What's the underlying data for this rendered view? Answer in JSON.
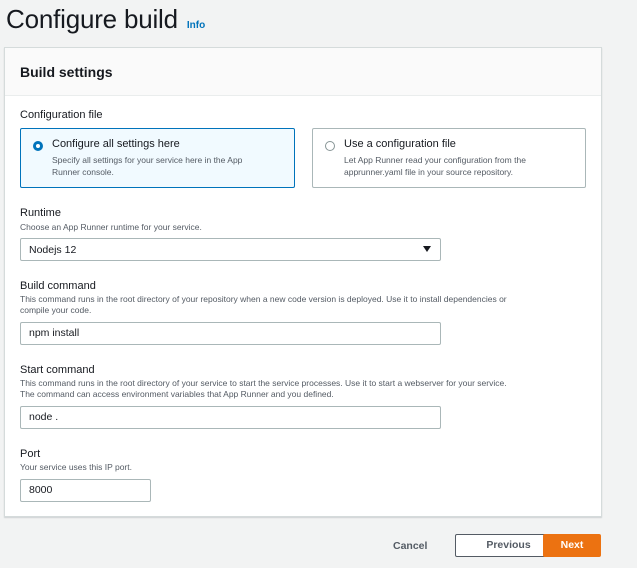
{
  "header": {
    "title": "Configure build",
    "info_label": "Info"
  },
  "build_settings": {
    "title": "Build settings",
    "configuration_file": {
      "label": "Configuration file",
      "options": [
        {
          "title": "Configure all settings here",
          "description_line1": "Specify all settings for your service here in the App",
          "description_line2": "Runner console.",
          "selected": true
        },
        {
          "title": "Use a configuration file",
          "description_line1": "Let App Runner read your configuration from the",
          "description_line2": "apprunner.yaml file in your source repository.",
          "selected": false
        }
      ]
    },
    "runtime": {
      "label": "Runtime",
      "description": "Choose an App Runner runtime for your service.",
      "selected_value": "Nodejs 12"
    },
    "build_command": {
      "label": "Build command",
      "description_line1": "This command runs in the root directory of your repository when a new code version is deployed. Use it to install dependencies or",
      "description_line2": "compile your code.",
      "value": "npm install"
    },
    "start_command": {
      "label": "Start command",
      "description_line1": "This command runs in the root directory of your service to start the service processes. Use it to start a webserver for your service.",
      "description_line2": "The command can access environment variables that App Runner and you defined.",
      "value": "node ."
    },
    "port": {
      "label": "Port",
      "description": "Your service uses this IP port.",
      "value": "8000"
    }
  },
  "footer": {
    "cancel_label": "Cancel",
    "previous_label": "Previous",
    "next_label": "Next"
  },
  "colors": {
    "accent_blue": "#0073bb",
    "primary_orange": "#ec7211",
    "background": "#f2f3f3"
  }
}
